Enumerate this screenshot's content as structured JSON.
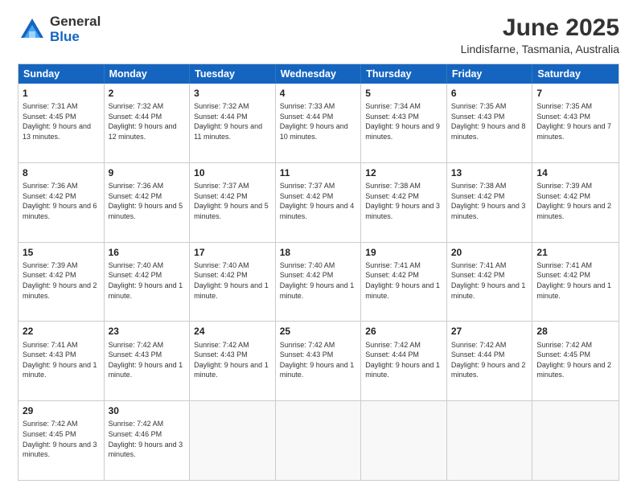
{
  "logo": {
    "general": "General",
    "blue": "Blue"
  },
  "title": "June 2025",
  "subtitle": "Lindisfarne, Tasmania, Australia",
  "header_days": [
    "Sunday",
    "Monday",
    "Tuesday",
    "Wednesday",
    "Thursday",
    "Friday",
    "Saturday"
  ],
  "weeks": [
    [
      {
        "day": "1",
        "sunrise": "7:31 AM",
        "sunset": "4:45 PM",
        "daylight": "9 hours and 13 minutes."
      },
      {
        "day": "2",
        "sunrise": "7:32 AM",
        "sunset": "4:44 PM",
        "daylight": "9 hours and 12 minutes."
      },
      {
        "day": "3",
        "sunrise": "7:32 AM",
        "sunset": "4:44 PM",
        "daylight": "9 hours and 11 minutes."
      },
      {
        "day": "4",
        "sunrise": "7:33 AM",
        "sunset": "4:44 PM",
        "daylight": "9 hours and 10 minutes."
      },
      {
        "day": "5",
        "sunrise": "7:34 AM",
        "sunset": "4:43 PM",
        "daylight": "9 hours and 9 minutes."
      },
      {
        "day": "6",
        "sunrise": "7:35 AM",
        "sunset": "4:43 PM",
        "daylight": "9 hours and 8 minutes."
      },
      {
        "day": "7",
        "sunrise": "7:35 AM",
        "sunset": "4:43 PM",
        "daylight": "9 hours and 7 minutes."
      }
    ],
    [
      {
        "day": "8",
        "sunrise": "7:36 AM",
        "sunset": "4:42 PM",
        "daylight": "9 hours and 6 minutes."
      },
      {
        "day": "9",
        "sunrise": "7:36 AM",
        "sunset": "4:42 PM",
        "daylight": "9 hours and 5 minutes."
      },
      {
        "day": "10",
        "sunrise": "7:37 AM",
        "sunset": "4:42 PM",
        "daylight": "9 hours and 5 minutes."
      },
      {
        "day": "11",
        "sunrise": "7:37 AM",
        "sunset": "4:42 PM",
        "daylight": "9 hours and 4 minutes."
      },
      {
        "day": "12",
        "sunrise": "7:38 AM",
        "sunset": "4:42 PM",
        "daylight": "9 hours and 3 minutes."
      },
      {
        "day": "13",
        "sunrise": "7:38 AM",
        "sunset": "4:42 PM",
        "daylight": "9 hours and 3 minutes."
      },
      {
        "day": "14",
        "sunrise": "7:39 AM",
        "sunset": "4:42 PM",
        "daylight": "9 hours and 2 minutes."
      }
    ],
    [
      {
        "day": "15",
        "sunrise": "7:39 AM",
        "sunset": "4:42 PM",
        "daylight": "9 hours and 2 minutes."
      },
      {
        "day": "16",
        "sunrise": "7:40 AM",
        "sunset": "4:42 PM",
        "daylight": "9 hours and 1 minute."
      },
      {
        "day": "17",
        "sunrise": "7:40 AM",
        "sunset": "4:42 PM",
        "daylight": "9 hours and 1 minute."
      },
      {
        "day": "18",
        "sunrise": "7:40 AM",
        "sunset": "4:42 PM",
        "daylight": "9 hours and 1 minute."
      },
      {
        "day": "19",
        "sunrise": "7:41 AM",
        "sunset": "4:42 PM",
        "daylight": "9 hours and 1 minute."
      },
      {
        "day": "20",
        "sunrise": "7:41 AM",
        "sunset": "4:42 PM",
        "daylight": "9 hours and 1 minute."
      },
      {
        "day": "21",
        "sunrise": "7:41 AM",
        "sunset": "4:42 PM",
        "daylight": "9 hours and 1 minute."
      }
    ],
    [
      {
        "day": "22",
        "sunrise": "7:41 AM",
        "sunset": "4:43 PM",
        "daylight": "9 hours and 1 minute."
      },
      {
        "day": "23",
        "sunrise": "7:42 AM",
        "sunset": "4:43 PM",
        "daylight": "9 hours and 1 minute."
      },
      {
        "day": "24",
        "sunrise": "7:42 AM",
        "sunset": "4:43 PM",
        "daylight": "9 hours and 1 minute."
      },
      {
        "day": "25",
        "sunrise": "7:42 AM",
        "sunset": "4:43 PM",
        "daylight": "9 hours and 1 minute."
      },
      {
        "day": "26",
        "sunrise": "7:42 AM",
        "sunset": "4:44 PM",
        "daylight": "9 hours and 1 minute."
      },
      {
        "day": "27",
        "sunrise": "7:42 AM",
        "sunset": "4:44 PM",
        "daylight": "9 hours and 2 minutes."
      },
      {
        "day": "28",
        "sunrise": "7:42 AM",
        "sunset": "4:45 PM",
        "daylight": "9 hours and 2 minutes."
      }
    ],
    [
      {
        "day": "29",
        "sunrise": "7:42 AM",
        "sunset": "4:45 PM",
        "daylight": "9 hours and 3 minutes."
      },
      {
        "day": "30",
        "sunrise": "7:42 AM",
        "sunset": "4:46 PM",
        "daylight": "9 hours and 3 minutes."
      },
      {
        "day": "",
        "sunrise": "",
        "sunset": "",
        "daylight": ""
      },
      {
        "day": "",
        "sunrise": "",
        "sunset": "",
        "daylight": ""
      },
      {
        "day": "",
        "sunrise": "",
        "sunset": "",
        "daylight": ""
      },
      {
        "day": "",
        "sunrise": "",
        "sunset": "",
        "daylight": ""
      },
      {
        "day": "",
        "sunrise": "",
        "sunset": "",
        "daylight": ""
      }
    ]
  ],
  "labels": {
    "sunrise": "Sunrise:",
    "sunset": "Sunset:",
    "daylight": "Daylight:"
  }
}
